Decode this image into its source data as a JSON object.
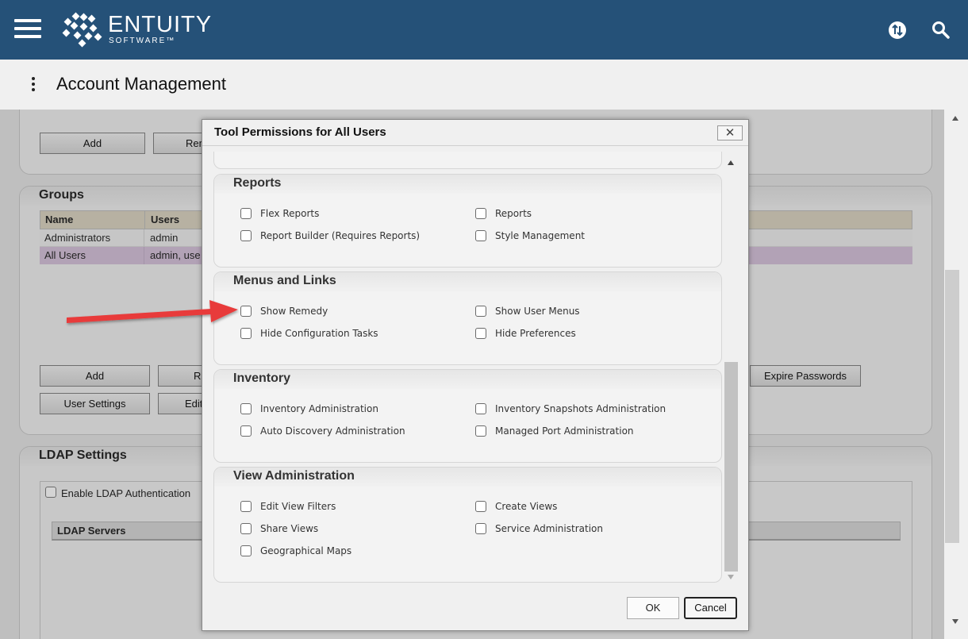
{
  "header": {
    "brand": "ENTUITY",
    "brand_sub": "SOFTWARE™",
    "icons": [
      "menu-icon",
      "entuity-logo",
      "sync-icon",
      "search-icon"
    ],
    "colors": {
      "bar": "#255178"
    }
  },
  "page": {
    "title": "Account Management"
  },
  "background": {
    "top_panel": {
      "add_label": "Add",
      "remove_label_partial": "Rem"
    },
    "groups": {
      "title": "Groups",
      "columns": [
        "Name",
        "Users"
      ],
      "rows": [
        {
          "name": "Administrators",
          "users": "admin"
        },
        {
          "name": "All Users",
          "users": "admin, use"
        }
      ],
      "buttons": {
        "add": "Add",
        "remove_partial": "R",
        "user_settings": "User Settings",
        "edit_partial": "Edit",
        "expire_passwords": "Expire Passwords"
      }
    },
    "ldap": {
      "title": "LDAP Settings",
      "enable_label": "Enable LDAP Authentication",
      "servers_header": "LDAP Servers"
    }
  },
  "dialog": {
    "title": "Tool Permissions for All Users",
    "close_symbol": "✕",
    "sections": [
      {
        "title": "Reports",
        "options": [
          "Flex Reports",
          "Reports",
          "Report Builder (Requires Reports)",
          "Style Management"
        ]
      },
      {
        "title": "Menus and Links",
        "options": [
          "Show Remedy",
          "Show User Menus",
          "Hide Configuration Tasks",
          "Hide Preferences"
        ]
      },
      {
        "title": "Inventory",
        "options": [
          "Inventory Administration",
          "Inventory Snapshots Administration",
          "Auto Discovery Administration",
          "Managed Port Administration"
        ]
      },
      {
        "title": "View Administration",
        "options": [
          "Edit View Filters",
          "Create Views",
          "Share Views",
          "Service Administration",
          "Geographical Maps"
        ]
      }
    ],
    "ok_label": "OK",
    "cancel_label": "Cancel"
  },
  "annotation": {
    "arrow_color": "#e83a3a"
  }
}
